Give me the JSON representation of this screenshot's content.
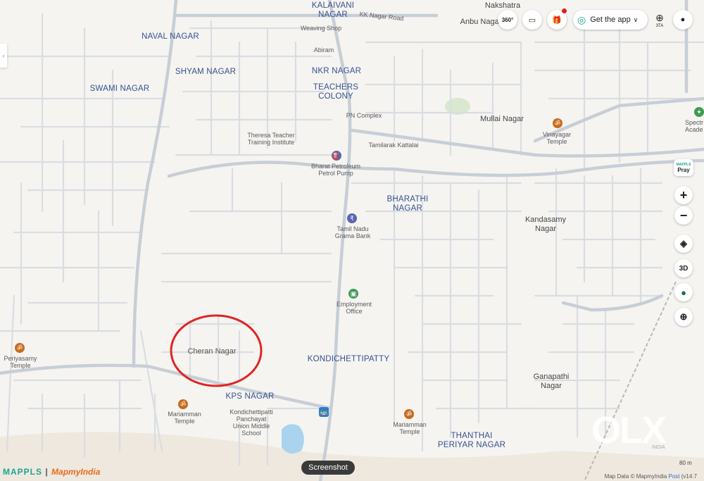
{
  "map": {
    "areas": [
      {
        "id": "kalaivani",
        "text": "KALAIVANI\nNAGAR"
      },
      {
        "id": "naval",
        "text": "NAVAL NAGAR"
      },
      {
        "id": "shyam",
        "text": "SHYAM NAGAR"
      },
      {
        "id": "nkr",
        "text": "NKR NAGAR"
      },
      {
        "id": "swami",
        "text": "SWAMI NAGAR"
      },
      {
        "id": "teachers",
        "text": "TEACHERS\nCOLONY"
      },
      {
        "id": "bharathi",
        "text": "BHARATHI\nNAGAR"
      },
      {
        "id": "kondi",
        "text": "KONDICHETTIPATTY"
      },
      {
        "id": "kps",
        "text": "KPS NAGAR"
      },
      {
        "id": "thanthai",
        "text": "THANTHAI\nPERIYAR NAGAR"
      }
    ],
    "localities": [
      {
        "id": "nakshatra",
        "text": "Nakshatra"
      },
      {
        "id": "anbu",
        "text": "Anbu Nagar"
      },
      {
        "id": "mullai",
        "text": "Mullai Nagar"
      },
      {
        "id": "kandasamy",
        "text": "Kandasamy\nNagar"
      },
      {
        "id": "cheran",
        "text": "Cheran Nagar"
      },
      {
        "id": "ganapathi",
        "text": "Ganapathi\nNagar"
      }
    ],
    "roads": [
      {
        "id": "kknagar",
        "text": "KK Nagar Road"
      }
    ],
    "pois": [
      {
        "id": "weaving",
        "text": "Weaving Shop"
      },
      {
        "id": "abiram",
        "text": "Abiram"
      },
      {
        "id": "pncomplex",
        "text": "PN Complex"
      },
      {
        "id": "theresa",
        "text": "Theresa Teacher\nTraining Institute"
      },
      {
        "id": "tamilarak",
        "text": "Tamilarak Kattalai"
      },
      {
        "id": "bharat",
        "text": "Bharat Petroleum\nPetrol Pump"
      },
      {
        "id": "tnbank",
        "text": "Tamil Nadu\nGrama Bank"
      },
      {
        "id": "employment",
        "text": "Employment\nOffice"
      },
      {
        "id": "vinayagar",
        "text": "Vinayagar\nTemple"
      },
      {
        "id": "periyasamy",
        "text": "Periyasamy\nTemple"
      },
      {
        "id": "mariamman1",
        "text": "Mariamman\nTemple"
      },
      {
        "id": "mariamman2",
        "text": "Mariamman\nTemple"
      },
      {
        "id": "school",
        "text": "Kondichettipatti\nPanchayat\nUnion Middle\nSchool"
      },
      {
        "id": "spectra",
        "text": "Spectr\nAcade"
      }
    ],
    "highlight": {
      "target": "Cheran Nagar",
      "color": "#e02424"
    }
  },
  "topbar": {
    "get_app": "Get the app",
    "icons": [
      "360-view-icon",
      "ruler-icon",
      "gift-icon",
      "fingerprint-icon",
      "globe-icon",
      "user-icon"
    ],
    "lang_sub": "3TA"
  },
  "controls": {
    "pray": "Pray",
    "pray_top": "MAPPLS",
    "zoom_in": "+",
    "zoom_out": "−",
    "three_d": "3D"
  },
  "brand": {
    "left": "MAPPLS",
    "sep": " | ",
    "right": "MapmyIndia"
  },
  "screenshot_label": "Screenshot",
  "footer": {
    "data": "Map Data © MapmyIndia",
    "post": "Post",
    "version": "(v14.7"
  },
  "scale": "80 m",
  "watermark": {
    "text": "OLX",
    "sub": "INDIA"
  },
  "colors": {
    "background": "#f6f4f1",
    "road": "#d9dde2",
    "highway": "#c7ced6",
    "accent": "#1aa58e",
    "highlight": "#e02424"
  }
}
